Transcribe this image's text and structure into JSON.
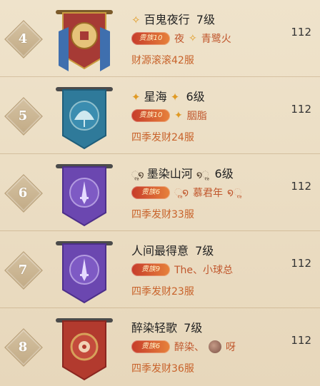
{
  "rows": [
    {
      "rank": "4",
      "emblem_icon": "coin-icon",
      "banner_colors": {
        "main": "#a63a35",
        "accent": "#3f6fae",
        "trim": "#c99b3f"
      },
      "guild_prefix": "",
      "guild_name": "百鬼夜行",
      "guild_suffix": "",
      "level": "7级",
      "vip": "贵族10",
      "leader": "夜",
      "leader_tail": "青鹭火",
      "server": "财源滚滚42服",
      "score": "112"
    },
    {
      "rank": "5",
      "emblem_icon": "fan-icon",
      "banner_colors": {
        "main": "#2f7a9a",
        "accent": "#1f5e7a",
        "trim": "#8fbfcc"
      },
      "guild_prefix": "",
      "guild_name": "星海",
      "guild_suffix": "",
      "level": "6级",
      "vip": "贵族10",
      "leader": "",
      "leader_tail": "胭脂",
      "server": "四季发财24服",
      "score": "112"
    },
    {
      "rank": "6",
      "emblem_icon": "sword-icon",
      "banner_colors": {
        "main": "#6b47b0",
        "accent": "#4d2f8a",
        "trim": "#b39be0"
      },
      "guild_prefix": "",
      "guild_name": "墨染山河",
      "guild_suffix": "",
      "level": "6级",
      "vip": "贵族6",
      "leader": "慕君年",
      "leader_tail": "",
      "server": "四季发财33服",
      "score": "112"
    },
    {
      "rank": "7",
      "emblem_icon": "sword-icon",
      "banner_colors": {
        "main": "#6b47b0",
        "accent": "#4d2f8a",
        "trim": "#b39be0"
      },
      "guild_prefix": "",
      "guild_name": "人间最得意",
      "guild_suffix": "",
      "level": "7级",
      "vip": "贵族9",
      "leader": "The、小球总",
      "leader_tail": "",
      "server": "四季发财23服",
      "score": "112"
    },
    {
      "rank": "8",
      "emblem_icon": "gear-icon",
      "banner_colors": {
        "main": "#b23a2e",
        "accent": "#8a2620",
        "trim": "#d7a15a"
      },
      "guild_prefix": "",
      "guild_name": "醉染轻歌",
      "guild_suffix": "",
      "level": "7级",
      "vip": "贵族6",
      "leader": "醉染、",
      "leader_tail": "呀",
      "server": "四季发财36服",
      "score": "112"
    }
  ]
}
